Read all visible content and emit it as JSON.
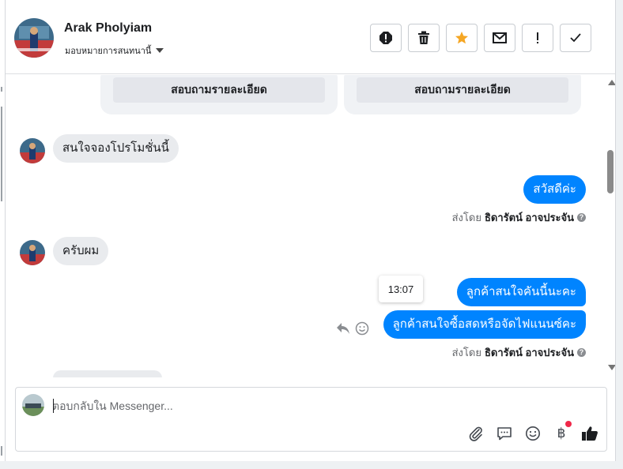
{
  "colors": {
    "accent": "#0084ff",
    "star": "#f5a623",
    "incoming_bubble": "#e9ebee",
    "notification": "#f02849"
  },
  "header": {
    "contact_name": "Arak Pholyiam",
    "assign_label": "มอบหมายการสนทนานี้",
    "actions": [
      {
        "name": "spam-icon",
        "tooltip": ""
      },
      {
        "name": "trash-icon",
        "tooltip": ""
      },
      {
        "name": "star-icon",
        "tooltip": ""
      },
      {
        "name": "mail-icon",
        "tooltip": ""
      },
      {
        "name": "exclamation-icon",
        "tooltip": ""
      },
      {
        "name": "checkmark-icon",
        "tooltip": ""
      }
    ]
  },
  "cards": [
    {
      "button_label": "สอบถามรายละเอียด"
    },
    {
      "button_label": "สอบถามรายละเอียด"
    }
  ],
  "messages": [
    {
      "direction": "in",
      "text": "สนใจจองโปรโมชั่นนี้"
    },
    {
      "direction": "out",
      "text": "สวัสดีค่ะ"
    },
    {
      "direction": "in",
      "text": "ครับผม"
    },
    {
      "direction": "out",
      "text": "ลูกค้าสนใจคันนี้นะคะ"
    },
    {
      "direction": "out",
      "text": "ลูกค้าสนใจซื้อสดหรือจัดไฟแนนซ์คะ"
    }
  ],
  "sent_by": {
    "prefix": "ส่งโดย",
    "agent": "ธิดารัตน์ อาจประจัน",
    "help": "?"
  },
  "timestamp_tooltip": "13:07",
  "composer": {
    "placeholder": "ตอบกลับใน Messenger...",
    "tools": [
      "paperclip-icon",
      "saved-replies-icon",
      "emoji-icon",
      "baht-payment-icon",
      "thumbs-up-icon"
    ],
    "baht_symbol": "฿"
  }
}
